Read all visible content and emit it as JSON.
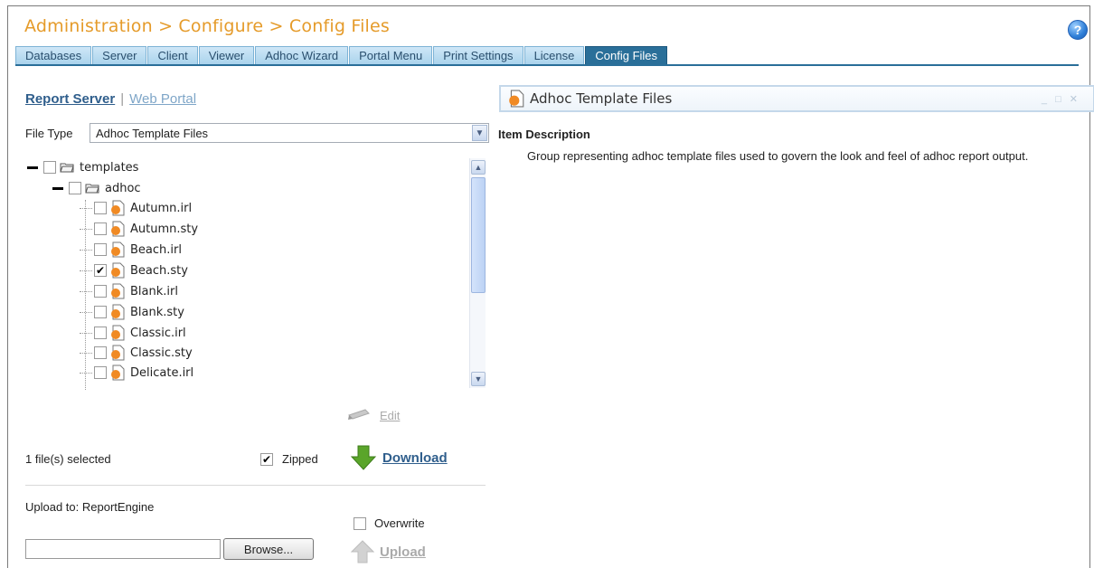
{
  "header": {
    "breadcrumb": "Administration > Configure > Config Files"
  },
  "tabs": [
    {
      "label": "Databases",
      "active": false
    },
    {
      "label": "Server",
      "active": false
    },
    {
      "label": "Client",
      "active": false
    },
    {
      "label": "Viewer",
      "active": false
    },
    {
      "label": "Adhoc Wizard",
      "active": false
    },
    {
      "label": "Portal Menu",
      "active": false
    },
    {
      "label": "Print Settings",
      "active": false
    },
    {
      "label": "License",
      "active": false
    },
    {
      "label": "Config Files",
      "active": true
    }
  ],
  "modes": {
    "active": "Report Server",
    "separator": "|",
    "other": "Web Portal"
  },
  "file_type": {
    "label": "File Type",
    "value": "Adhoc Template Files"
  },
  "tree": {
    "root": {
      "label": "templates",
      "checked": false
    },
    "folder": {
      "label": "adhoc",
      "checked": false
    },
    "files": [
      {
        "label": "Autumn.irl",
        "checked": false
      },
      {
        "label": "Autumn.sty",
        "checked": false
      },
      {
        "label": "Beach.irl",
        "checked": false
      },
      {
        "label": "Beach.sty",
        "checked": true
      },
      {
        "label": "Blank.irl",
        "checked": false
      },
      {
        "label": "Blank.sty",
        "checked": false
      },
      {
        "label": "Classic.irl",
        "checked": false
      },
      {
        "label": "Classic.sty",
        "checked": false
      },
      {
        "label": "Delicate.irl",
        "checked": false
      }
    ]
  },
  "actions": {
    "edit": "Edit",
    "selected_count": "1 file(s) selected",
    "zipped": {
      "label": "Zipped",
      "checked": true
    },
    "download": "Download",
    "upload_to": "Upload to: ReportEngine",
    "overwrite": {
      "label": "Overwrite",
      "checked": false
    },
    "browse": "Browse...",
    "upload": "Upload"
  },
  "panel": {
    "title": "Adhoc Template Files",
    "item_description_label": "Item Description",
    "description": "Group representing adhoc template files used to govern the look and feel of adhoc report output."
  },
  "colors": {
    "accent": "#2a6f99",
    "title": "#e59b2a",
    "link": "#2f5e8c"
  }
}
